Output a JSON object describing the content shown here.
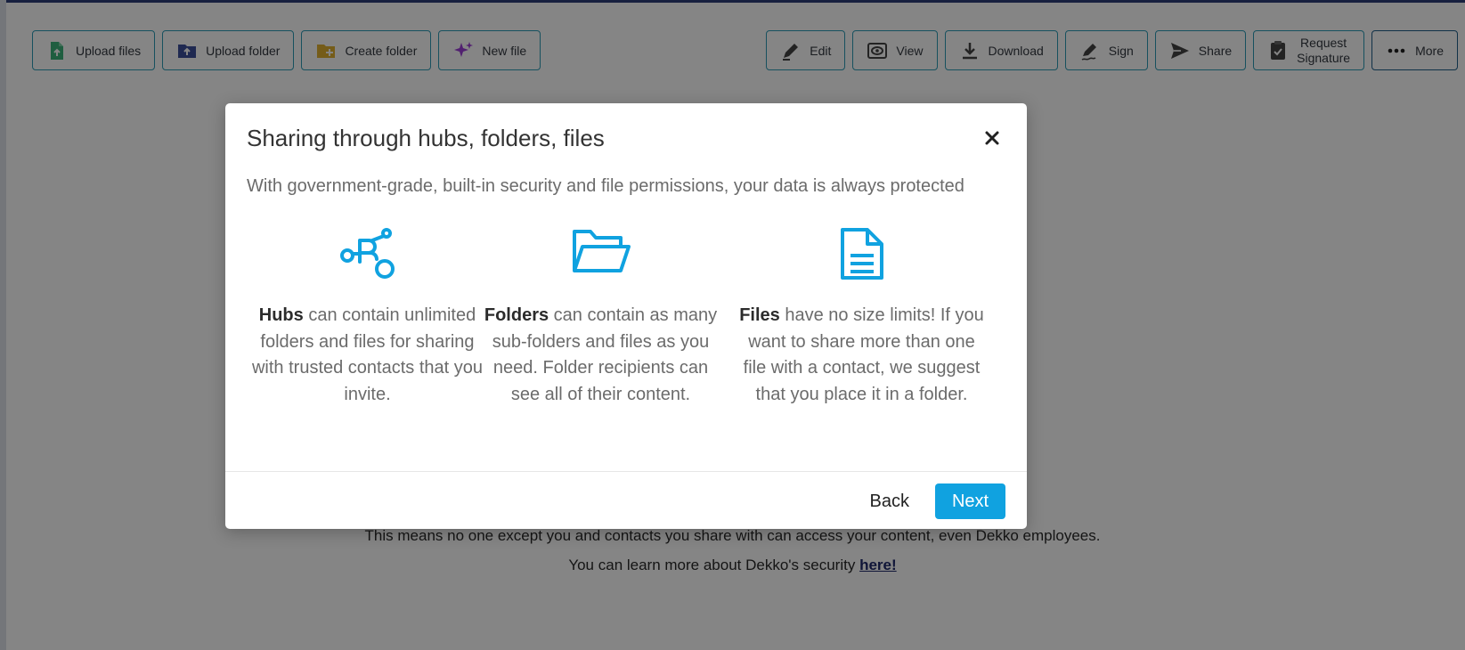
{
  "toolbar": {
    "left": [
      {
        "label": "Upload files",
        "icon": "upload-file-icon",
        "color": "#3cb47b"
      },
      {
        "label": "Upload folder",
        "icon": "upload-folder-icon",
        "color": "#3d4f9c"
      },
      {
        "label": "Create folder",
        "icon": "create-folder-icon",
        "color": "#e0b030"
      },
      {
        "label": "New file",
        "icon": "sparkle-icon",
        "color": "#9b3fd6"
      }
    ],
    "right": [
      {
        "label": "Edit",
        "icon": "edit-icon"
      },
      {
        "label": "View",
        "icon": "eye-icon"
      },
      {
        "label": "Download",
        "icon": "download-icon"
      },
      {
        "label": "Sign",
        "icon": "sign-icon"
      },
      {
        "label": "Share",
        "icon": "share-icon"
      },
      {
        "label_line1": "Request",
        "label_line2": "Signature",
        "icon": "request-signature-icon"
      },
      {
        "label": "More",
        "icon": "more-dots-icon"
      }
    ]
  },
  "background": {
    "line1": "This means no one except you and contacts you share with can access your content, even Dekko employees.",
    "line2_prefix": "You can learn more about Dekko's security ",
    "line2_link": "here!"
  },
  "modal": {
    "title": "Sharing through hubs, folders, files",
    "subtitle": "With government-grade, built-in security and file permissions, your data is always protected",
    "features": [
      {
        "icon": "hubs-icon",
        "bold": "Hubs",
        "text": " can contain unlimited folders and files for sharing with trusted contacts that you invite."
      },
      {
        "icon": "folder-open-icon",
        "bold": "Folders",
        "text": " can contain as many sub-folders and files as you need. Folder recipients can see all of their content."
      },
      {
        "icon": "document-icon",
        "bold": "Files",
        "text": " have no size limits! If you want to share more than one file with a contact, we suggest that you place it in a folder."
      }
    ],
    "back_label": "Back",
    "next_label": "Next",
    "accent_color": "#10a2e0"
  }
}
